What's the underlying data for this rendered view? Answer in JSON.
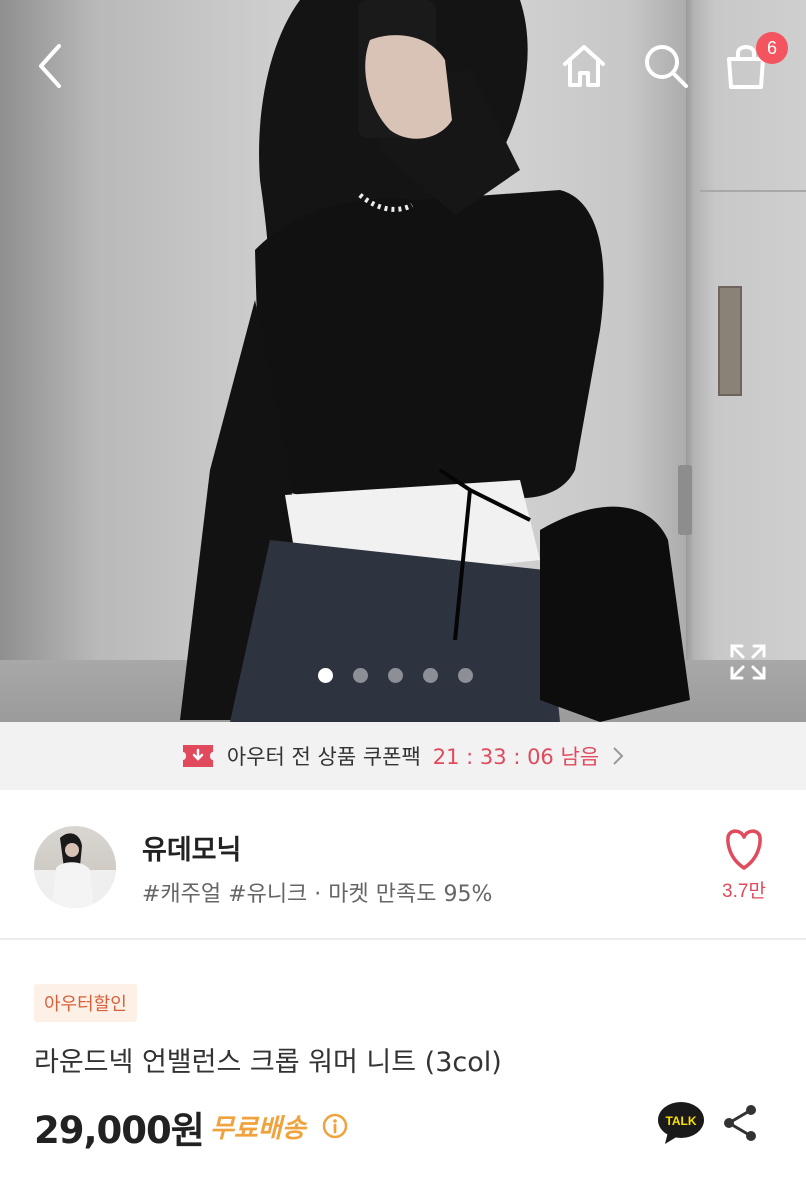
{
  "colors": {
    "accent_red": "#e14a5c",
    "badge_red": "#f4545f",
    "shipping_orange": "#f0a23c",
    "badge_bg": "#fdf0e6",
    "badge_text": "#d86038"
  },
  "header": {
    "cart_count": "6",
    "icons": [
      "back-arrow-icon",
      "home-icon",
      "search-icon",
      "shopping-bag-icon"
    ]
  },
  "gallery": {
    "total_images": 5,
    "active_index": 0,
    "fullscreen_icon": "expand-icon"
  },
  "coupon_banner": {
    "text": "아우터 전 상품 쿠폰팩",
    "timer": "21 : 33 : 06 남음",
    "icon": "coupon-ticket-icon"
  },
  "store": {
    "name": "유데모닉",
    "tags": "#캐주얼 #유니크 · 마켓 만족도 95%",
    "likes": "3.7만"
  },
  "product": {
    "badge": "아우터할인",
    "title": "라운드넥 언밸런스 크롭 워머 니트 (3col)",
    "price": "29,000원",
    "shipping": "무료배송",
    "talk_label": "TALK"
  }
}
